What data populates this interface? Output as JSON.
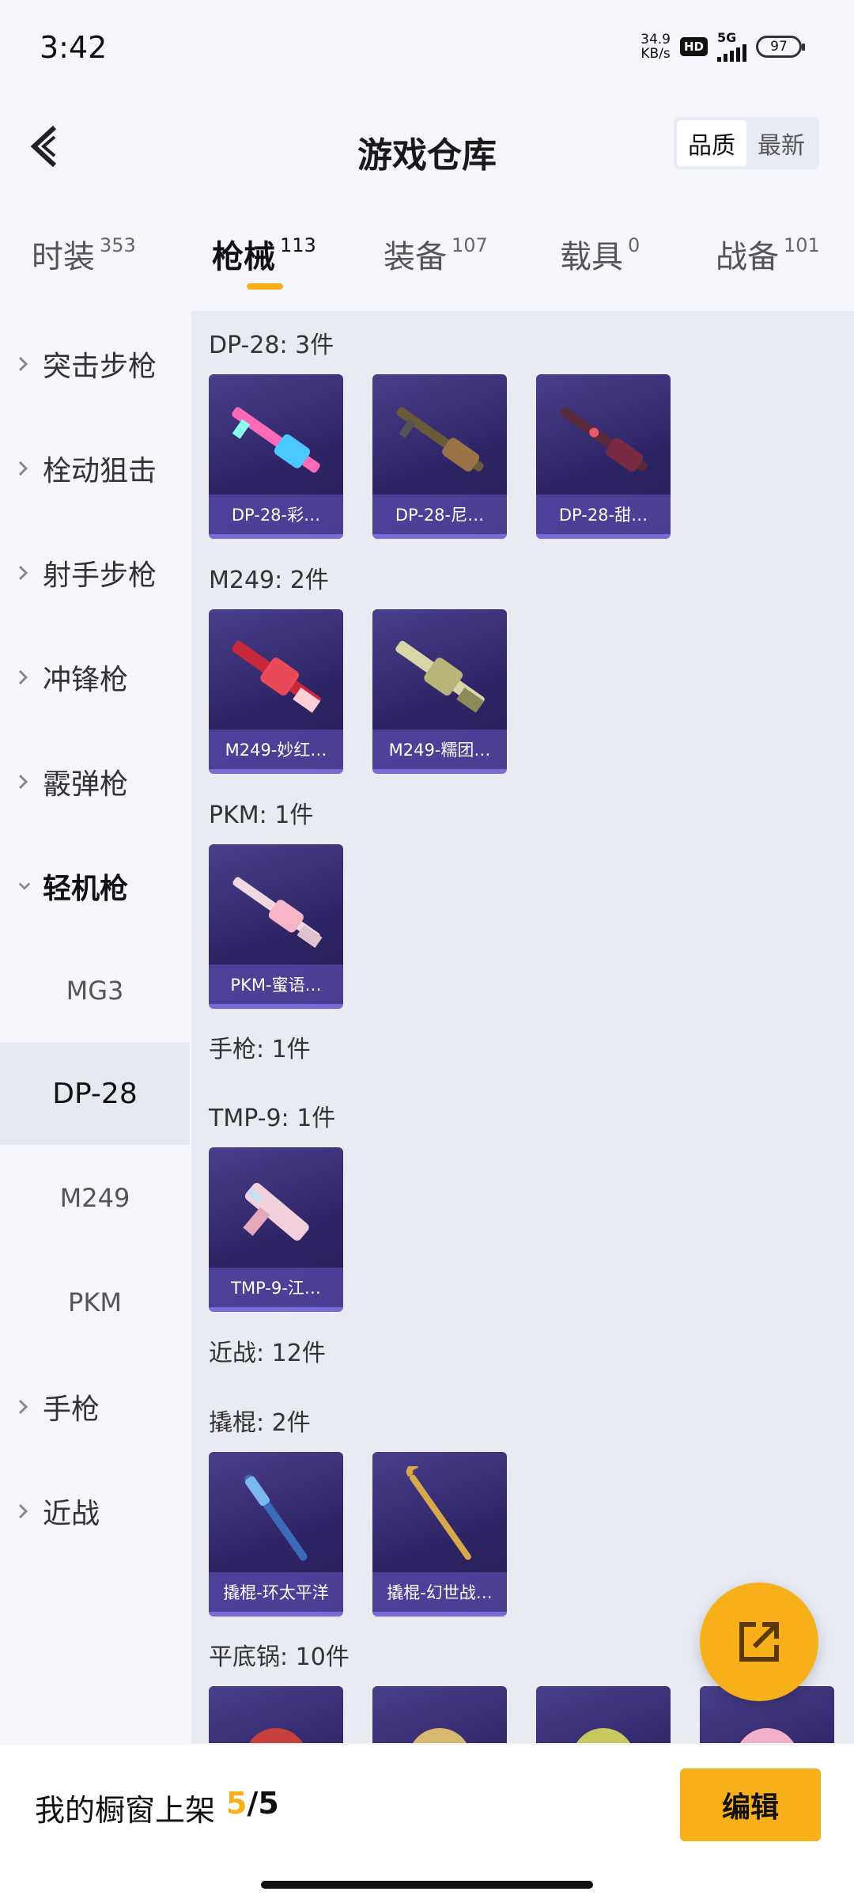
{
  "status": {
    "time": "3:42",
    "net_speed_value": "34.9",
    "net_speed_unit": "KB/s",
    "hd": "HD",
    "network": "5G",
    "battery": "97"
  },
  "header": {
    "title": "游戏仓库",
    "sort_options": [
      "品质",
      "最新"
    ]
  },
  "category_tabs": [
    {
      "label": "时装",
      "count": "353"
    },
    {
      "label": "枪械",
      "count": "113"
    },
    {
      "label": "装备",
      "count": "107"
    },
    {
      "label": "载具",
      "count": "0"
    },
    {
      "label": "战备",
      "count": "101"
    }
  ],
  "sidebar": {
    "items": [
      "突击步枪",
      "栓动狙击",
      "射手步枪",
      "冲锋枪",
      "霰弹枪",
      "轻机枪"
    ],
    "sub_items": [
      "MG3",
      "DP-28",
      "M249",
      "PKM"
    ],
    "items_after": [
      "手枪",
      "近战"
    ]
  },
  "groups": [
    {
      "title": "DP-28: 3件",
      "cards": [
        "DP-28-彩…",
        "DP-28-尼…",
        "DP-28-甜…"
      ]
    },
    {
      "title": "M249: 2件",
      "cards": [
        "M249-妙红…",
        "M249-糯团…"
      ]
    },
    {
      "title": "PKM: 1件",
      "cards": [
        "PKM-蜜语…"
      ]
    },
    {
      "title": "手枪: 1件"
    },
    {
      "title": "TMP-9: 1件",
      "cards": [
        "TMP-9-江…"
      ]
    },
    {
      "title": "近战: 12件"
    },
    {
      "title": "撬棍: 2件",
      "cards": [
        "撬棍-环太平洋",
        "撬棍-幻世战…"
      ]
    },
    {
      "title": "平底锅: 10件"
    }
  ],
  "bottom": {
    "showcase_label": "我的橱窗上架",
    "showcase_count": "5",
    "showcase_total": "/5",
    "edit_label": "编辑"
  },
  "colors": {
    "accent": "#f8b01a",
    "card_bg": "#2f2566",
    "card_border": "#7a6ad6"
  },
  "icons": [
    "back-arrow-icon",
    "chevron-right-icon",
    "chevron-down-icon",
    "share-export-icon"
  ]
}
